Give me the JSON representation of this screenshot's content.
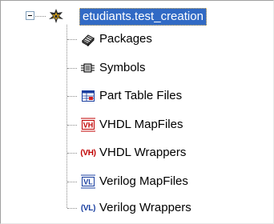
{
  "tree": {
    "root": {
      "label": "etudiants.test_creation",
      "expander_state": "expanded",
      "icon": "project-component-icon",
      "selected": true
    },
    "items": [
      {
        "label": "Packages",
        "icon": "packages-icon"
      },
      {
        "label": "Symbols",
        "icon": "symbols-icon"
      },
      {
        "label": "Part Table Files",
        "icon": "part-table-icon"
      },
      {
        "label": "VHDL MapFiles",
        "icon": "vhdl-mapfile-icon",
        "icon_text": "VH"
      },
      {
        "label": "VHDL Wrappers",
        "icon": "vhdl-wrapper-icon",
        "icon_text": "(VH)"
      },
      {
        "label": "Verilog MapFiles",
        "icon": "verilog-mapfile-icon",
        "icon_text": "VL"
      },
      {
        "label": "Verilog Wrappers",
        "icon": "verilog-wrapper-icon",
        "icon_text": "(VL)"
      }
    ]
  },
  "colors": {
    "selection": "#316ac5",
    "hdl_red": "#c00000",
    "hdl_blue": "#1a3fa0"
  }
}
